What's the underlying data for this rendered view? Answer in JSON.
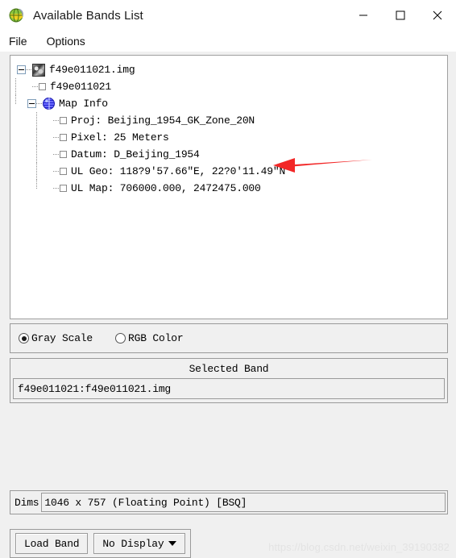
{
  "window": {
    "title": "Available Bands List",
    "app_icon": "envi-globe-icon",
    "controls": {
      "minimize": "minimize-icon",
      "maximize": "maximize-icon",
      "close": "close-icon"
    }
  },
  "menubar": {
    "items": [
      {
        "label": "File"
      },
      {
        "label": "Options"
      }
    ]
  },
  "tree": {
    "nodes": [
      {
        "label": "f49e011021.img",
        "icon": "image-thumbnail-icon",
        "level": 0,
        "expanded": true
      },
      {
        "label": "f49e011021",
        "icon": "band-checkbox-icon",
        "level": 1,
        "expanded": false
      },
      {
        "label": "Map Info",
        "icon": "globe-icon",
        "level": 1,
        "expanded": true
      },
      {
        "label": "Proj: Beijing_1954_GK_Zone_20N",
        "icon": "band-checkbox-icon",
        "level": 2,
        "expanded": false
      },
      {
        "label": "Pixel: 25 Meters",
        "icon": "band-checkbox-icon",
        "level": 2,
        "expanded": false
      },
      {
        "label": "Datum: D_Beijing_1954",
        "icon": "band-checkbox-icon",
        "level": 2,
        "expanded": false
      },
      {
        "label": "UL Geo: 118?9'57.66\"E,  22?0'11.49\"N",
        "icon": "band-checkbox-icon",
        "level": 2,
        "expanded": false
      },
      {
        "label": "UL Map: 706000.000,  2472475.000",
        "icon": "band-checkbox-icon",
        "level": 2,
        "expanded": false
      }
    ]
  },
  "color_mode": {
    "options": [
      {
        "label": "Gray Scale",
        "selected": true
      },
      {
        "label": "RGB Color",
        "selected": false
      }
    ]
  },
  "selected_band": {
    "title": "Selected Band",
    "value": "f49e011021:f49e011021.img"
  },
  "dims": {
    "label": "Dims",
    "value": "1046 x 757 (Floating Point) [BSQ]"
  },
  "actions": {
    "load_band": "Load Band",
    "display_mode": "No Display",
    "display_caret": "chevron-down-icon"
  },
  "annotation": {
    "arrow": "red-left-arrow",
    "color": "#f22727"
  },
  "watermark": {
    "text": "https://blog.csdn.net/weixin_39190382"
  }
}
